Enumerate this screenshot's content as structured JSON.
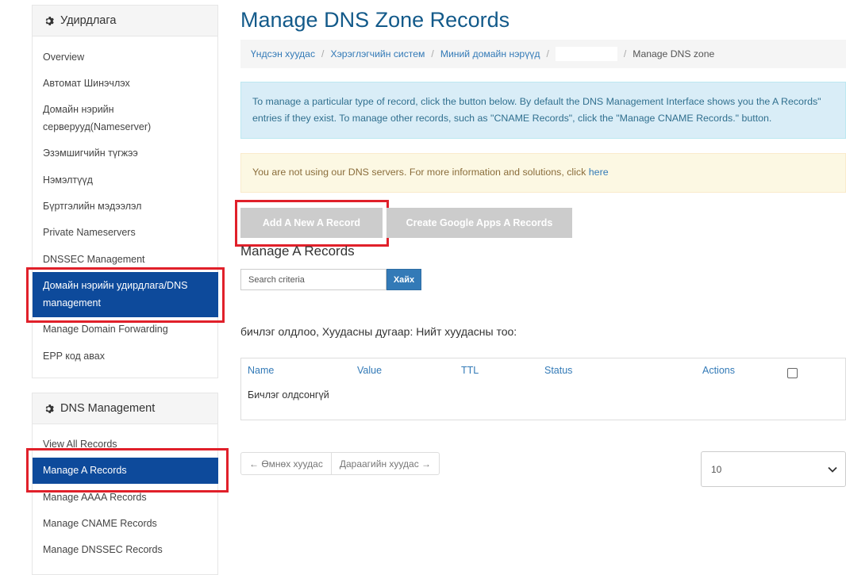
{
  "sidebar": {
    "panel1": {
      "title": "Удирдлага",
      "items": [
        "Overview",
        "Автомат Шинэчлэх",
        "Домайн нэрийн",
        "серверууд(Nameserver)",
        "Эзэмшигчийн түгжээ",
        "Нэмэлтүүд",
        "Бүртгэлийн мэдээлэл",
        "Private Nameservers",
        "DNSSEC Management",
        "Домайн нэрийн удирдлага/DNS",
        "management",
        "Manage Domain Forwarding",
        "EPP код авах"
      ]
    },
    "panel2": {
      "title": "DNS Management",
      "items": [
        "View All Records",
        "Manage A Records",
        "Manage AAAA Records",
        "Manage CNAME Records",
        "Manage DNSSEC Records"
      ]
    }
  },
  "main": {
    "title": "Manage DNS Zone Records",
    "breadcrumb": [
      "Үндсэн хуудас",
      "Хэрэглэгчийн систем",
      "Миний домайн нэрүүд",
      "Manage DNS zone"
    ],
    "info_text": "To manage a particular type of record, click the button below. By default the DNS Management Interface shows you the  A Records\" entries if they exist. To manage other records, such as \"CNAME Records\", click the \"Manage CNAME Records.\" button.",
    "warning_text": "You are not using our DNS servers. For more information and solutions, click ",
    "warning_link": "here",
    "add_button": "Add A New A Record",
    "google_button": "Create Google Apps A Records",
    "section_title": "Manage A Records",
    "search_placeholder": "Search criteria",
    "search_button": "Хайх",
    "records_info": "бичлэг олдлоо, Хуудасны дугаар: Нийт хуудасны тоо:",
    "table": {
      "columns": [
        "Name",
        "Value",
        "TTL",
        "Status",
        "Actions"
      ],
      "empty": "Бичлэг олдсонгүй"
    },
    "pager": {
      "prev": "← Өмнөх хуудас",
      "next": "Дараагийн хуудас →"
    },
    "per_page": "10"
  },
  "colors": {
    "title": "#135a8a",
    "active": "#0d4a9b",
    "highlight": "#e0202a",
    "link": "#337ab7"
  },
  "icons": [
    "gear-icon",
    "chevron-down-icon"
  ]
}
